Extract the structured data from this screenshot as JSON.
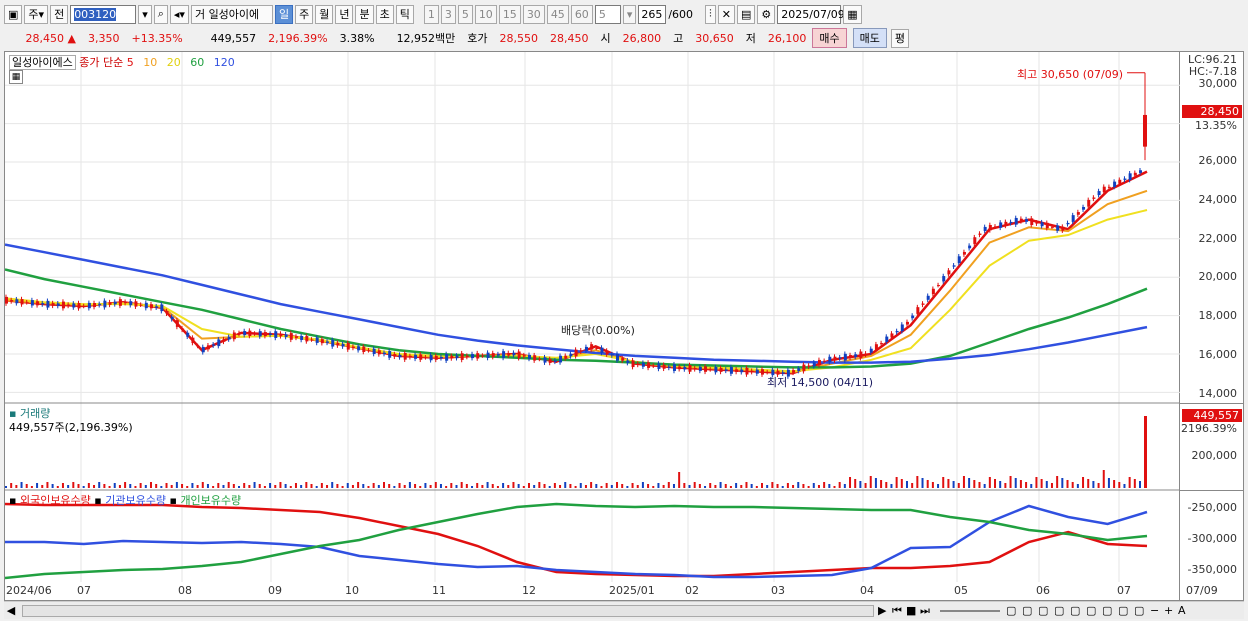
{
  "toolbar": {
    "mode": "주",
    "prev_label": "전",
    "code": "003120",
    "stock_name": "일성아이에",
    "name_prefix": "거",
    "periods": [
      "일",
      "주",
      "월",
      "년",
      "분",
      "초",
      "틱"
    ],
    "active_period": "일",
    "intervals": [
      "1",
      "3",
      "5",
      "10",
      "15",
      "30",
      "45",
      "60"
    ],
    "custom_interval": "5",
    "count_current": "265",
    "count_total": "/600",
    "date": "2025/07/09"
  },
  "quote": {
    "price": "28,450",
    "change": "3,350",
    "change_pct": "+13.35%",
    "volume": "449,557",
    "volume_pct": "2,196.39%",
    "turnover_pct": "3.38%",
    "amount": "12,952백만",
    "ask_label": "호가",
    "ask": "28,550",
    "bid": "28,450",
    "open_label": "시",
    "open": "26,800",
    "high_label": "고",
    "high": "30,650",
    "low_label": "저",
    "low": "26,100",
    "buy_label": "매수",
    "sell_label": "매도",
    "eval_label": "평"
  },
  "price_panel": {
    "title": "일성아이에스",
    "legend_prefix": "종가 단순",
    "ma_periods": [
      "5",
      "10",
      "20",
      "60",
      "120"
    ],
    "ma_colors": [
      "#e01010",
      "#f0a020",
      "#f0e020",
      "#20a040",
      "#3050e0"
    ],
    "lc": "LC:96.21",
    "hc": "HC:-7.18",
    "last_price_tag": "28,450",
    "last_pct_tag": "13.35%",
    "high_note": "최고 30,650 (07/09)",
    "low_note": "최저 14,500 (04/11)",
    "dividend_note": "배당락(0.00%)",
    "y_ticks": [
      "30,000",
      "28,000",
      "26,000",
      "24,000",
      "22,000",
      "20,000",
      "18,000",
      "16,000",
      "14,000"
    ]
  },
  "volume_panel": {
    "title": "거래량",
    "value_note": "449,557주(2,196.39%)",
    "tag_value": "449,557",
    "tag_pct": "2196.39%",
    "y_ticks": [
      "200,000"
    ]
  },
  "holding_panel": {
    "labels": [
      "외국인보유수량",
      "기관보유수량",
      "개인보유수량"
    ],
    "colors": [
      "#e01010",
      "#3050e0",
      "#20a040"
    ],
    "y_ticks": [
      "-250,000",
      "-300,000",
      "-350,000"
    ]
  },
  "x_ticks": [
    "2024/06",
    "07",
    "08",
    "09",
    "10",
    "11",
    "12",
    "2025/01",
    "02",
    "03",
    "04",
    "05",
    "06",
    "07",
    "07/09"
  ],
  "chart_data": {
    "type": "line",
    "x_ticks": [
      "2024/06",
      "07",
      "08",
      "09",
      "10",
      "11",
      "12",
      "2025/01",
      "02",
      "03",
      "04",
      "05",
      "06",
      "07"
    ],
    "series": [
      {
        "name": "5",
        "values": [
          18800,
          18600,
          18500,
          18700,
          18400,
          16200,
          17100,
          17000,
          16700,
          16300,
          15900,
          15800,
          15900,
          16000,
          15600,
          16400,
          15500,
          15300,
          15200,
          15100,
          15000,
          15700,
          16000,
          17500,
          20000,
          22500,
          23000,
          22500,
          24500,
          25500
        ]
      },
      {
        "name": "10",
        "values": [
          18800,
          18650,
          18550,
          18650,
          18450,
          16800,
          16900,
          16950,
          16700,
          16300,
          15950,
          15850,
          15900,
          15950,
          15700,
          16200,
          15550,
          15350,
          15250,
          15150,
          15050,
          15500,
          15900,
          17000,
          19300,
          21800,
          22600,
          22400,
          23800,
          24500
        ]
      },
      {
        "name": "20",
        "values": [
          18900,
          18700,
          18600,
          18600,
          18500,
          17300,
          16900,
          16950,
          16750,
          16350,
          16000,
          15900,
          15900,
          15900,
          15800,
          16000,
          15600,
          15400,
          15300,
          15200,
          15100,
          15300,
          15700,
          16300,
          18300,
          20600,
          21900,
          22200,
          23000,
          23500
        ]
      },
      {
        "name": "60",
        "values": [
          20400,
          19900,
          19500,
          19100,
          18700,
          18300,
          17800,
          17300,
          16900,
          16500,
          16200,
          16000,
          15900,
          15800,
          15700,
          15650,
          15550,
          15450,
          15400,
          15350,
          15300,
          15300,
          15350,
          15500,
          15900,
          16600,
          17300,
          17900,
          18600,
          19400
        ]
      },
      {
        "name": "120",
        "values": [
          21700,
          21300,
          20900,
          20500,
          20100,
          19600,
          19100,
          18600,
          18200,
          17800,
          17400,
          17000,
          16700,
          16450,
          16250,
          16050,
          15900,
          15800,
          15700,
          15650,
          15600,
          15550,
          15550,
          15600,
          15750,
          15950,
          16250,
          16600,
          17000,
          17400
        ]
      }
    ],
    "ylim": [
      13500,
      31000
    ],
    "annotations": [
      "최고 30,650 (07/09)",
      "최저 14,500 (04/11)",
      "배당락(0.00%)"
    ]
  }
}
